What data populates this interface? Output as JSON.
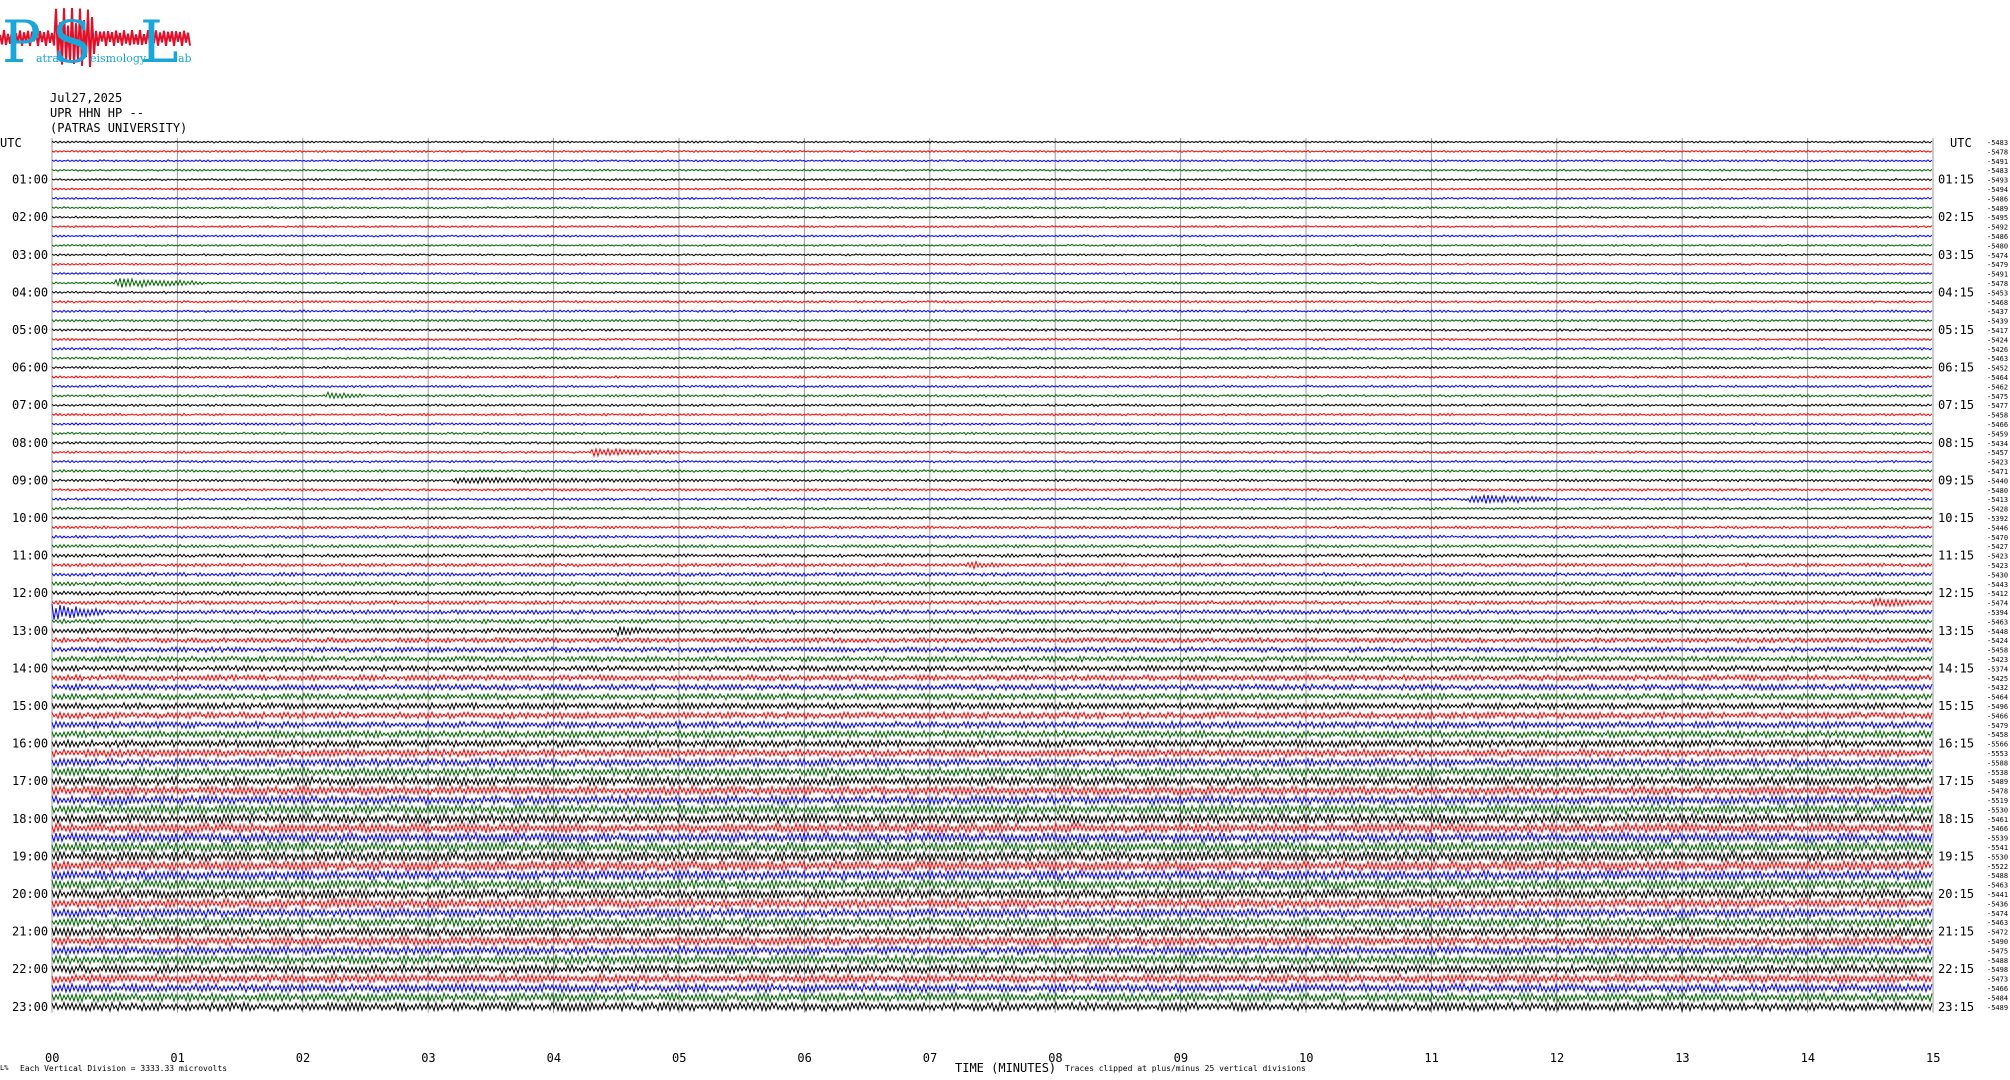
{
  "logo": {
    "letters": [
      "P",
      "S",
      "L"
    ],
    "words": [
      "atras",
      "eismology",
      "ab"
    ],
    "colors": {
      "letters": "#1aa6d8",
      "wave": "#e0102a"
    }
  },
  "header": {
    "date": "Jul27,2025",
    "station": "UPR HHN HP --",
    "institution": "(PATRAS UNIVERSITY)"
  },
  "axes": {
    "left_label": "UTC",
    "right_label": "UTC",
    "x_title": "TIME (MINUTES)",
    "x_ticks": [
      "00",
      "01",
      "02",
      "03",
      "04",
      "05",
      "06",
      "07",
      "08",
      "09",
      "10",
      "11",
      "12",
      "13",
      "14",
      "15"
    ],
    "left_hours": [
      "01:00",
      "02:00",
      "03:00",
      "04:00",
      "05:00",
      "06:00",
      "07:00",
      "08:00",
      "09:00",
      "10:00",
      "11:00",
      "12:00",
      "13:00",
      "14:00",
      "15:00",
      "16:00",
      "17:00",
      "18:00",
      "19:00",
      "20:00",
      "21:00",
      "22:00",
      "23:00"
    ],
    "right_hours": [
      "01:15",
      "02:15",
      "03:15",
      "04:15",
      "05:15",
      "06:15",
      "07:15",
      "08:15",
      "09:15",
      "10:15",
      "11:15",
      "12:15",
      "13:15",
      "14:15",
      "15:15",
      "16:15",
      "17:15",
      "18:15",
      "19:15",
      "20:15",
      "21:15",
      "22:15",
      "23:15"
    ]
  },
  "footer": {
    "left_mark": "L%",
    "scale_note": "Each Vertical Division = 3333.33 microvolts",
    "clip_note": "Traces clipped at plus/minus 25 vertical divisions"
  },
  "chart_data": {
    "type": "line",
    "description_axis": "minutes",
    "xlim": [
      0,
      15
    ],
    "trace_minutes": 15,
    "rows_per_hour": 4,
    "trace_colors": [
      "#000000",
      "#ff0000",
      "#0000ff",
      "#006400"
    ],
    "grid": true,
    "right_values": [
      "-5483",
      "-5478",
      "-5491",
      "-5483",
      "-5493",
      "-5494",
      "-5486",
      "-5489",
      "-5495",
      "-5492",
      "-5486",
      "-5480",
      "-5474",
      "-5479",
      "-5491",
      "-5478",
      "-5453",
      "-5468",
      "-5437",
      "-5439",
      "-5417",
      "-5424",
      "-5426",
      "-5463",
      "-5452",
      "-5464",
      "-5462",
      "-5475",
      "-5477",
      "-5458",
      "-5466",
      "-5459",
      "-5434",
      "-5457",
      "-5423",
      "-5471",
      "-5440",
      "-5480",
      "-5413",
      "-5428",
      "-5392",
      "-5446",
      "-5470",
      "-5427",
      "-5423",
      "-5423",
      "-5430",
      "-5443",
      "-5412",
      "-5474",
      "-5394",
      "-5463",
      "-5448",
      "-5424",
      "-5458",
      "-5423",
      "-5374",
      "-5425",
      "-5432",
      "-5464",
      "-5496",
      "-5466",
      "-5479",
      "-5458",
      "-5566",
      "-5553",
      "-5588",
      "-5538",
      "-5489",
      "-5478",
      "-5519",
      "-5530",
      "-5461",
      "-5466",
      "-5539",
      "-5541",
      "-5530",
      "-5522",
      "-5488",
      "-5463",
      "-5441",
      "-5436",
      "-5474",
      "-5463",
      "-5472",
      "-5490",
      "-5475",
      "-5488",
      "-5498",
      "-5473",
      "-5466",
      "-5484",
      "-5489"
    ],
    "row_amplitude": [
      1,
      1,
      1,
      1,
      1,
      1,
      1,
      1,
      1,
      1,
      1,
      1,
      1,
      1,
      1,
      1,
      1.2,
      1.2,
      1.2,
      1.2,
      1.2,
      1.2,
      1.2,
      1.2,
      1.2,
      1.2,
      1.2,
      1.2,
      1.2,
      1.2,
      1.2,
      1.2,
      1.2,
      1.2,
      1.2,
      1.3,
      1.3,
      1.3,
      1.3,
      1.3,
      1.3,
      1.4,
      1.5,
      1.6,
      1.7,
      1.8,
      1.9,
      2,
      2,
      2,
      2.2,
      2.2,
      2.4,
      2.5,
      2.6,
      2.7,
      2.8,
      2.9,
      3,
      3.1,
      3.2,
      3.3,
      3.4,
      3.5,
      3.7,
      3.8,
      4,
      4.1,
      4.2,
      4.3,
      4.4,
      4.5,
      4.6,
      4.7,
      4.8,
      4.9,
      5,
      4.9,
      4.8,
      4.7,
      4.6,
      4.5,
      4.5,
      4.4,
      4.4,
      4.3,
      4.3,
      4.3,
      4.2,
      4.2,
      4.2,
      4.2,
      4.2
    ],
    "events": [
      {
        "row": 15,
        "start_min": 0.5,
        "end_min": 1.2,
        "amp": 5
      },
      {
        "row": 27,
        "start_min": 2.2,
        "end_min": 2.5,
        "amp": 4
      },
      {
        "row": 33,
        "start_min": 4.3,
        "end_min": 5.0,
        "amp": 4
      },
      {
        "row": 36,
        "start_min": 3.2,
        "end_min": 5.2,
        "amp": 3
      },
      {
        "row": 38,
        "start_min": 11.3,
        "end_min": 12.0,
        "amp": 5
      },
      {
        "row": 45,
        "start_min": 7.3,
        "end_min": 7.6,
        "amp": 4
      },
      {
        "row": 50,
        "start_min": 0,
        "end_min": 0.4,
        "amp": 8
      },
      {
        "row": 52,
        "start_min": 4.5,
        "end_min": 4.8,
        "amp": 5
      },
      {
        "row": 49,
        "start_min": 14.5,
        "end_min": 15,
        "amp": 5
      }
    ]
  }
}
